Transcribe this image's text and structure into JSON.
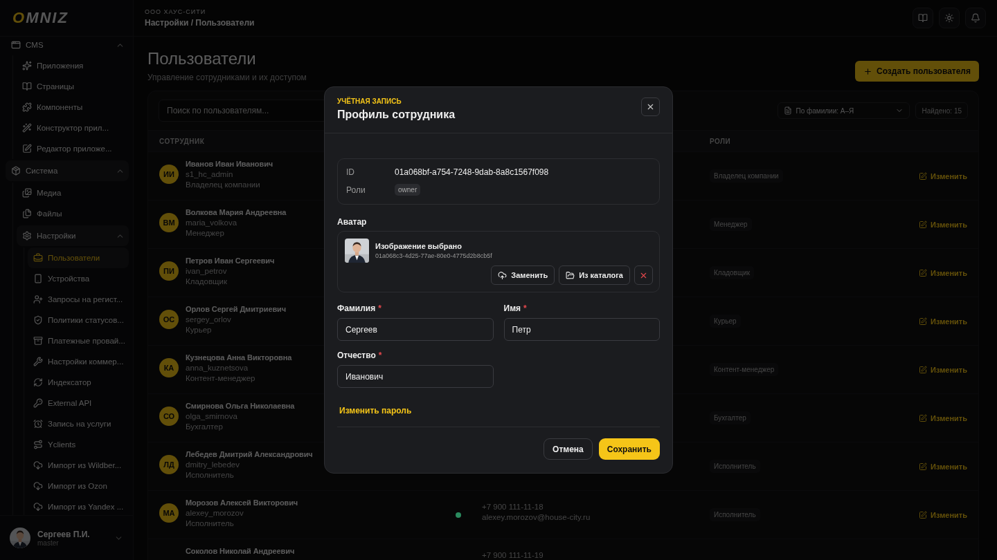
{
  "logo": {
    "accent": "O",
    "rest": "MNIZ"
  },
  "sidebar": {
    "items": [
      {
        "label": "CMS",
        "expanded": true,
        "selected": false,
        "children": [
          {
            "label": "Приложения",
            "selected": false
          },
          {
            "label": "Страницы",
            "selected": false
          },
          {
            "label": "Компоненты",
            "selected": false
          },
          {
            "label": "Конструктор прил...",
            "selected": false
          },
          {
            "label": "Редактор приложе...",
            "selected": false
          }
        ]
      },
      {
        "label": "Система",
        "expanded": true,
        "selected": false,
        "children": [
          {
            "label": "Медиа",
            "selected": false
          },
          {
            "label": "Файлы",
            "selected": false
          },
          {
            "label": "Настройки",
            "expanded": true,
            "selected": false,
            "children": [
              {
                "label": "Пользователи",
                "selected": true
              },
              {
                "label": "Устройства",
                "selected": false
              },
              {
                "label": "Запросы на регист...",
                "selected": false
              },
              {
                "label": "Политики статусов...",
                "selected": false
              },
              {
                "label": "Платежные провай...",
                "selected": false
              },
              {
                "label": "Настройки коммер...",
                "selected": false
              },
              {
                "label": "Индексатор",
                "selected": false
              },
              {
                "label": "External API",
                "selected": false
              },
              {
                "label": "Запись на услуги",
                "selected": false
              },
              {
                "label": "Yclients",
                "selected": false
              },
              {
                "label": "Импорт из Wildber...",
                "selected": false
              },
              {
                "label": "Импорт из Ozon",
                "selected": false
              },
              {
                "label": "Импорт из Yandex ...",
                "selected": false
              }
            ]
          }
        ]
      }
    ],
    "user": {
      "name": "Сергеев П.И.",
      "role": "master"
    }
  },
  "header": {
    "company": "ООО ХАУС-СИТИ",
    "breadcrumb": "Настройки / Пользователи"
  },
  "page": {
    "title": "Пользователи",
    "subtitle": "Управление сотрудниками и их доступом",
    "create_button": "Создать пользователя"
  },
  "table": {
    "search": {
      "placeholder": "Поиск по пользователям..."
    },
    "sort": "По фамилии: А–Я",
    "count": "Найдено: 15",
    "columns": {
      "employee": "СОТРУДНИК",
      "roles": "РОЛИ"
    },
    "rows": [
      {
        "initials": "ИИ",
        "name": "Иванов Иван Иванович",
        "login": "s1_hc_admin",
        "position": "Владелец компании",
        "role": "Владелец компании",
        "action": "Изменить"
      },
      {
        "initials": "ВМ",
        "name": "Волкова Мария Андреевна",
        "login": "maria_volkova",
        "position": "Менеджер",
        "role": "Менеджер",
        "action": "Изменить"
      },
      {
        "initials": "ПИ",
        "name": "Петров Иван Сергеевич",
        "login": "ivan_petrov",
        "position": "Кладовщик",
        "role": "Кладовщик",
        "action": "Изменить"
      },
      {
        "initials": "ОС",
        "name": "Орлов Сергей Дмитриевич",
        "login": "sergey_orlov",
        "position": "Курьер",
        "role": "Курьер",
        "action": "Изменить"
      },
      {
        "initials": "КА",
        "name": "Кузнецова Анна Викторовна",
        "login": "anna_kuznetsova",
        "position": "Контент-менеджер",
        "role": "Контент-менеджер",
        "action": "Изменить"
      },
      {
        "initials": "СО",
        "name": "Смирнова Ольга Николаевна",
        "login": "olga_smirnova",
        "position": "Бухгалтер",
        "role": "Бухгалтер",
        "action": "Изменить"
      },
      {
        "initials": "ЛД",
        "name": "Лебедев Дмитрий Александрович",
        "login": "dmitry_lebedev",
        "position": "Исполнитель",
        "role": "Исполнитель",
        "action": "Изменить"
      },
      {
        "initials": "МА",
        "name": "Морозов Алексей Викторович",
        "login": "alexey_morozov",
        "position": "Исполнитель",
        "role": "Исполнитель",
        "action": "Изменить",
        "color": "#2a8a5e",
        "phone": "+7 900 111-11-18",
        "email": "alexey.morozov@house-city.ru"
      },
      {
        "name": "Соколов Николай Андреевич",
        "phone": "+7 900 111-11-19"
      }
    ]
  },
  "modal": {
    "eyebrow": "УЧЁТНАЯ ЗАПИСЬ",
    "title": "Профиль сотрудника",
    "info": [
      {
        "label": "ID",
        "kind": "text",
        "value": "01a068bf-a754-7248-9dab-8a8c1567f098"
      },
      {
        "label": "Роли",
        "kind": "tags",
        "tags": [
          "owner"
        ]
      }
    ],
    "avatar": {
      "label": "Аватар",
      "status": "Изображение выбрано",
      "file_id": "01a068c3-4d25-77ae-80e0-4775d2b8cb5f",
      "replace_button": "Заменить",
      "catalog_button": "Из каталога"
    },
    "required_mark": "*",
    "fields": [
      {
        "label": "Фамилия",
        "required": true,
        "value": "Сергеев"
      },
      {
        "label": "Имя",
        "required": true,
        "value": "Петр"
      },
      {
        "label": "Отчество",
        "required": true,
        "value": "Иванович"
      }
    ],
    "password_link": "Изменить пароль",
    "cancel_button": "Отмена",
    "save_button": "Сохранить"
  }
}
